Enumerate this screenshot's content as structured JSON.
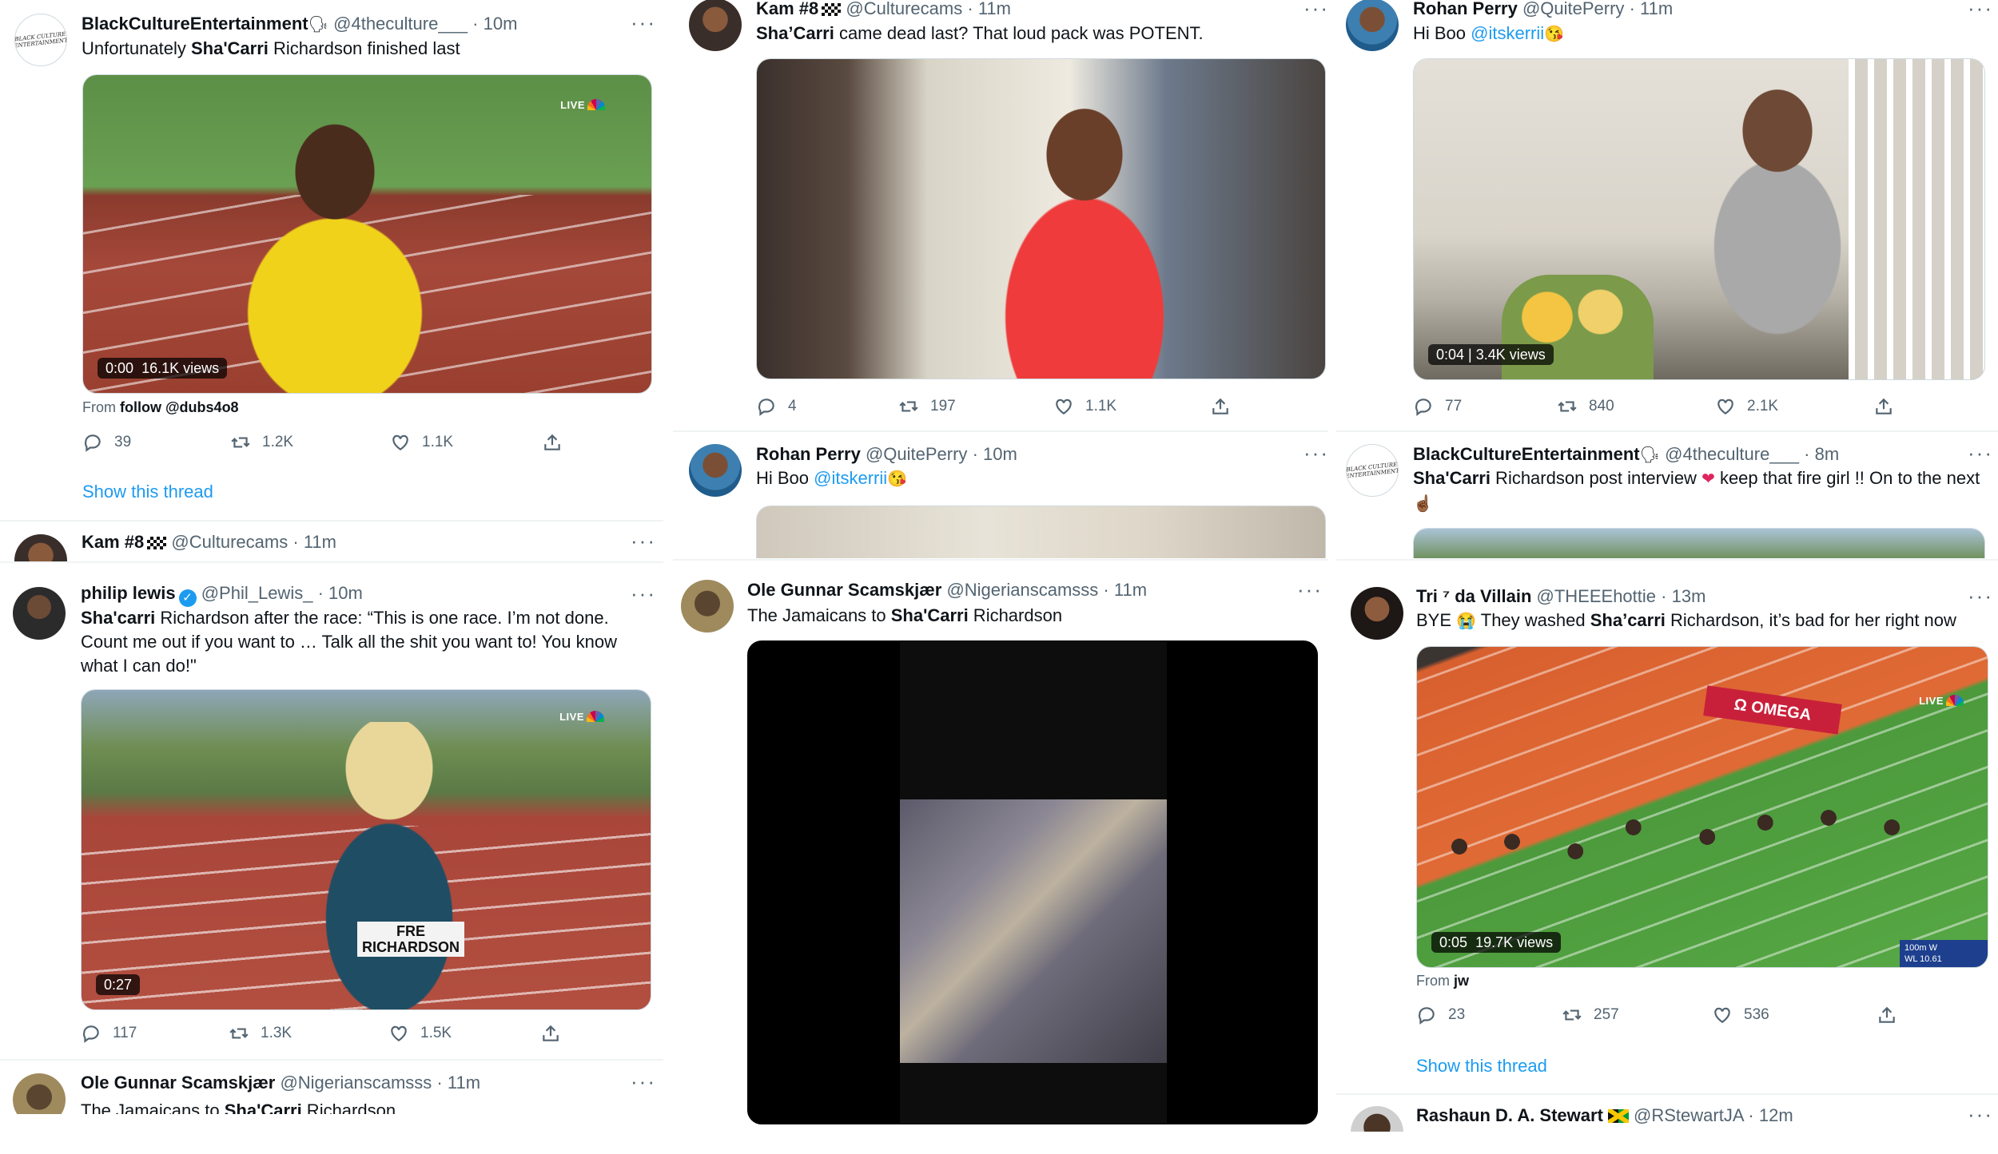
{
  "labels": {
    "dot": "·",
    "show_thread": "Show this thread",
    "from": "From"
  },
  "col1": {
    "t1": {
      "name": "BlackCultureEntertainment",
      "handle": "@4theculture___",
      "time": "10m",
      "avatar_text": "BLACK CULTURE ENTERTAINMENT",
      "text": {
        "a": "Unfortunately ",
        "b": "Sha'Carri",
        "c": " Richardson finished last"
      },
      "video": {
        "time": "0:00",
        "views": "16.1K views",
        "live": "LIVE"
      },
      "from_user": "follow @dubs4o8",
      "stats": {
        "replies": "39",
        "retweets": "1.2K",
        "likes": "1.1K"
      }
    },
    "t2": {
      "name": "Kam #8",
      "handle": "@Culturecams",
      "time": "11m"
    },
    "t3": {
      "name": "philip lewis",
      "handle": "@Phil_Lewis_",
      "time": "10m",
      "text": {
        "a": "Sha'carri",
        "b": " Richardson after the race: “This is one race. I’m not done. Count me out if you want to … Talk all the shit you want to! You know what I can do!\""
      },
      "video": {
        "time": "0:27",
        "live": "LIVE",
        "bib1": "FRE",
        "bib2": "RICHARDSON"
      },
      "stats": {
        "replies": "117",
        "retweets": "1.3K",
        "likes": "1.5K"
      }
    },
    "t4": {
      "name": "Ole Gunnar Scamskjær",
      "handle": "@Nigerianscamsss",
      "time": "11m",
      "text": {
        "a": "The Jamaicans to ",
        "b": "Sha'Carri",
        "c": " Richardson"
      }
    }
  },
  "col2": {
    "t1": {
      "name": "Kam #8",
      "handle": "@Culturecams",
      "time": "11m",
      "text": {
        "a": "Sha’Carri",
        "b": " came dead last? That loud pack was POTENT."
      },
      "stats": {
        "replies": "4",
        "retweets": "197",
        "likes": "1.1K"
      }
    },
    "t2": {
      "name": "Rohan Perry",
      "handle": "@QuitePerry",
      "time": "10m",
      "text": {
        "a": "Hi Boo ",
        "mention": "@itskerrii"
      }
    },
    "t3": {
      "name": "Ole Gunnar Scamskjær",
      "handle": "@Nigerianscamsss",
      "time": "11m",
      "text": {
        "a": "The Jamaicans to ",
        "b": "Sha'Carri",
        "c": " Richardson"
      }
    }
  },
  "col3": {
    "t1": {
      "name": "Rohan Perry",
      "handle": "@QuitePerry",
      "time": "11m",
      "text": {
        "a": "Hi Boo ",
        "mention": "@itskerrii"
      },
      "video": {
        "time": "0:04",
        "views": "3.4K views"
      },
      "stats": {
        "replies": "77",
        "retweets": "840",
        "likes": "2.1K"
      }
    },
    "t2": {
      "name": "BlackCultureEntertainment",
      "handle": "@4theculture___",
      "time": "8m",
      "avatar_text": "BLACK CULTURE ENTERTAINMENT",
      "text": {
        "a": "Sha'Carri",
        "b": " Richardson post interview ",
        "c": " keep that fire girl !! On to the next"
      }
    },
    "t3": {
      "name": "Tri ⁷ da Villain",
      "handle": "@THEEEhottie",
      "time": "13m",
      "text": {
        "a": "BYE ",
        "b": " They washed ",
        "c": "Sha’carri",
        "d": " Richardson, it’s bad for her right now"
      },
      "video": {
        "time": "0:05",
        "views": "19.7K views",
        "live": "LIVE",
        "sponsor": "Ω OMEGA",
        "overlay1": "100m W",
        "overlay2": "10.61",
        "overlay3": "WL"
      },
      "from_user": "jw",
      "stats": {
        "replies": "23",
        "retweets": "257",
        "likes": "536"
      }
    },
    "t4": {
      "name": "Rashaun D. A. Stewart",
      "handle": "@RStewartJA",
      "time": "12m"
    }
  }
}
